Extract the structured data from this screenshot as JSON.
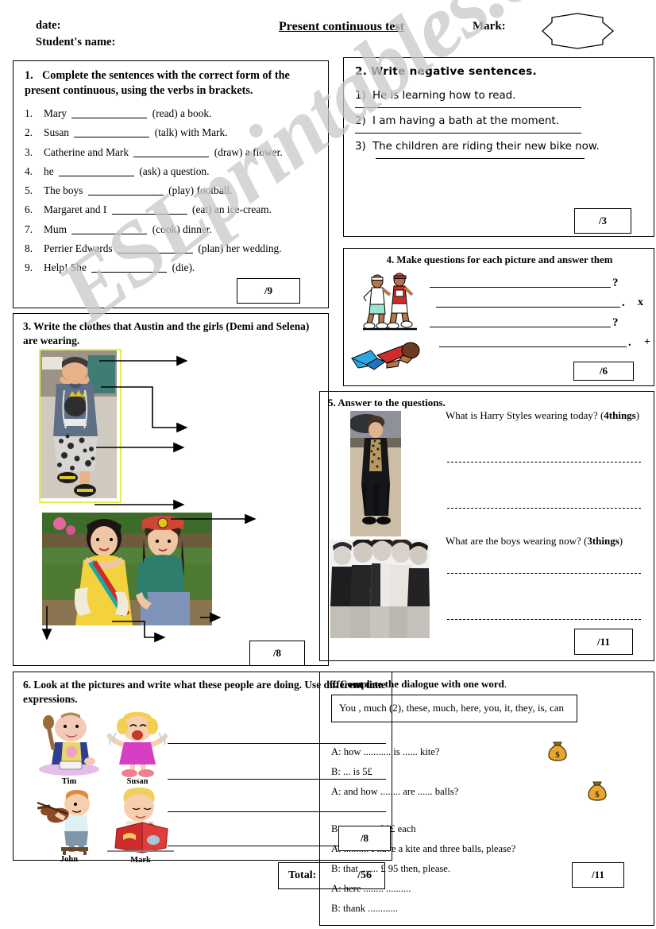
{
  "header": {
    "date_label": "date:",
    "student_label": "Student's name:",
    "title": "Present continuous test",
    "mark_label": "Mark:",
    "mark_value": ""
  },
  "section1": {
    "number": "1.",
    "instruction": "Complete the sentences with the correct form of the present continuous, using the verbs in brackets.",
    "items": [
      {
        "n": "1.",
        "before": "Mary",
        "after": "(read) a book."
      },
      {
        "n": "2.",
        "before": "Susan",
        "after": "(talk) with Mark."
      },
      {
        "n": "3.",
        "before": "Catherine and Mark",
        "after": "(draw) a flower."
      },
      {
        "n": "4.",
        "before": "he",
        "after": "(ask) a question."
      },
      {
        "n": "5.",
        "before": "The boys",
        "after": "(play) football."
      },
      {
        "n": "6.",
        "before": "Margaret and I",
        "after": "(eat) an ice-cream."
      },
      {
        "n": "7.",
        "before": "Mum",
        "after": "(cook) dinner."
      },
      {
        "n": "8.",
        "before": "Perrier Edwards",
        "after": "(plan) her wedding."
      },
      {
        "n": "9.",
        "before": "Help! She",
        "after": "(die)."
      }
    ],
    "score": "/9"
  },
  "section2": {
    "title": "2.  Write negative sentences.",
    "items": [
      {
        "n": "1)",
        "text": "He is learning how to read."
      },
      {
        "n": "2)",
        "text": "I am having a bath at the moment."
      },
      {
        "n": "3)",
        "text": "The children are riding their new bike now."
      }
    ],
    "score": "/3"
  },
  "section3": {
    "title": "3. Write the clothes that Austin and the girls (Demi and Selena) are wearing.",
    "image_austin": "austin-photo",
    "image_girls": "demi-and-selena-photo",
    "score": "/8"
  },
  "section4": {
    "title": "4. Make questions for each picture and answer them",
    "image_runners": "runners-clipart",
    "image_faller": "falling-man-clipart",
    "rows": [
      {
        "mark": "?",
        "side": ""
      },
      {
        "mark": ".",
        "side": "x"
      },
      {
        "mark": "?",
        "side": ""
      },
      {
        "mark": ".",
        "side": "+"
      }
    ],
    "score": "/6"
  },
  "section5": {
    "title": "5. Answer to the questions.",
    "image_harry": "harry-styles-photo",
    "image_boys": "one-direction-photo",
    "question1": "What is Harry Styles wearing today? (",
    "question1_bold": "4things",
    "question1_end": ")",
    "question2": "What are the boys wearing now? (",
    "question2_bold": "3things",
    "question2_end": ")",
    "score": "/11"
  },
  "section6_left": {
    "title": "6. Look at the pictures and write what these people are doing. Use different time expressions.",
    "pictures": [
      {
        "name": "tim-cooking-clipart",
        "caption": "Tim"
      },
      {
        "name": "susan-crying-clipart",
        "caption": "Susan"
      },
      {
        "name": "john-violin-clipart",
        "caption": "John"
      },
      {
        "name": "mark-reading-clipart",
        "caption": "Mark"
      }
    ],
    "score": "/8"
  },
  "section6_right": {
    "title_plain": "6. Complete the dialogue with one word",
    "title_dot": ".",
    "wordbank": "You , much (2), these, much, here, you, it, they, is, can",
    "lines": [
      "A: how ........... is ...... kite?",
      "B:  ...   is 5£",
      "A:  and  how ........ are ...... balls?",
      "B ......... are 30£ each",
      "A: ..........  I have a kite and three balls, please?",
      "B: that ....... £ 95 then, please.",
      "A: here ........  ..........",
      "B: thank ............"
    ],
    "bags": [
      "money-bag-icon",
      "money-bag-icon"
    ],
    "score": "/11"
  },
  "total": {
    "label": "Total:",
    "value": "/56"
  },
  "watermark": {
    "text": "ESLprintables.com"
  }
}
